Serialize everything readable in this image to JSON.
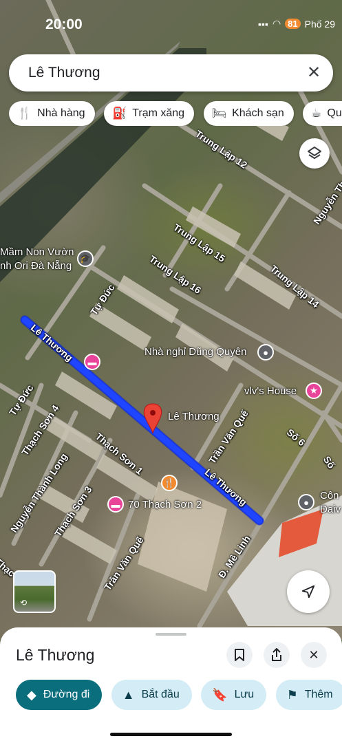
{
  "status_bar": {
    "time": "20:00",
    "notification_badge": "81",
    "weather": "Phố 29"
  },
  "search": {
    "query": "Lê Thương",
    "clear_icon": "close-icon"
  },
  "chips": [
    {
      "label": "Nhà hàng",
      "icon": "restaurant-icon"
    },
    {
      "label": "Trạm xăng",
      "icon": "gas-station-icon"
    },
    {
      "label": "Khách sạn",
      "icon": "hotel-icon"
    },
    {
      "label": "Quán c",
      "icon": "cafe-icon"
    }
  ],
  "map": {
    "streets": {
      "le_thuong_1": "Lê Thương",
      "le_thuong_2": "Lê Thương",
      "trung_lap_12": "Trung Lập 12",
      "trung_lap_15": "Trung Lập 15",
      "trung_lap_16": "Trung Lập 16",
      "trung_lap_14": "Trung Lập 14",
      "tu_duc_1": "Tự Đức",
      "tu_duc_2": "Tự Đức",
      "thach_son_4": "Thạch Sơn 4",
      "thach_son_1": "Thạch Sơn 1",
      "thach_son_3": "Thạch Sơn 3",
      "nguyen_thanh_long": "Nguyễn Thành Long",
      "tran_van_que_1": "Trần Văn Quế",
      "tran_van_que_2": "Trần Văn Quế",
      "me_linh": "Đ. Mê Linh",
      "so_6": "Số 6",
      "nguyen_th": "Nguyễn Th",
      "so_edge": "Số",
      "thach_edge": "Thạc"
    },
    "pois": {
      "school_line1": "Mầm Non Vườn",
      "school_line2": "nh Ori Đà Nẵng",
      "guesthouse": "Nhà nghỉ Dũng Quyên",
      "vivs_house": "vlv's House",
      "pin_label": "Lê Thương",
      "thach_son_hotel": "70 Thạch Sơn 2",
      "company_line1": "Côn",
      "company_line2": "Daiv"
    }
  },
  "place": {
    "title": "Lê Thương",
    "actions": [
      {
        "label": "Đường đi",
        "icon": "directions-icon",
        "primary": true
      },
      {
        "label": "Bắt đầu",
        "icon": "navigation-arrow-icon",
        "primary": false
      },
      {
        "label": "Lưu",
        "icon": "bookmark-icon",
        "primary": false
      },
      {
        "label": "Thêm",
        "icon": "flag-icon",
        "primary": false
      }
    ]
  },
  "colors": {
    "route": "#1a3cf0",
    "pin": "#ea4335",
    "primary_button": "#0b6e7d",
    "hotel_pin": "#e8459a",
    "restaurant_pin": "#f28b2f"
  }
}
